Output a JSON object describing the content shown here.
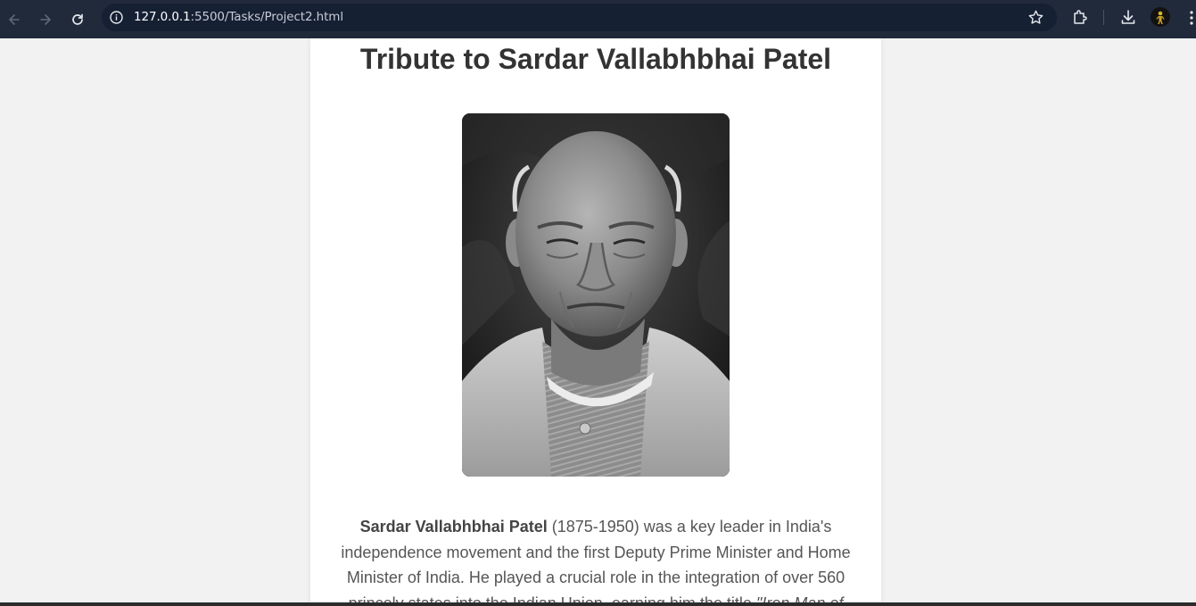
{
  "browser": {
    "url_host": "127.0.0.1",
    "url_rest": ":5500/Tasks/Project2.html",
    "icons": [
      "back-arrow-icon",
      "forward-arrow-icon",
      "reload-icon",
      "site-info-icon",
      "bookmark-star-icon",
      "extensions-icon",
      "download-icon",
      "profile-avatar-icon",
      "more-menu-icon"
    ]
  },
  "page": {
    "title": "Tribute to Sardar Vallabhbhai Patel",
    "image_alt": "Sardar Vallabhbhai Patel portrait",
    "bio": {
      "name": "Sardar Vallabhbhai Patel",
      "text_1": " (1875-1950) was a key leader in India's independence movement and the first Deputy Prime Minister and Home Minister of India. He played a crucial role in the integration of over 560 princely states into the Indian Union, earning him the title ",
      "title_quote": "\"Iron Man of"
    }
  },
  "colors": {
    "toolbar": "#202a3b",
    "omnibox": "#162033",
    "page_bg": "#f2f2f2",
    "card_bg": "#ffffff",
    "heading": "#333333",
    "body_text": "#555555"
  }
}
